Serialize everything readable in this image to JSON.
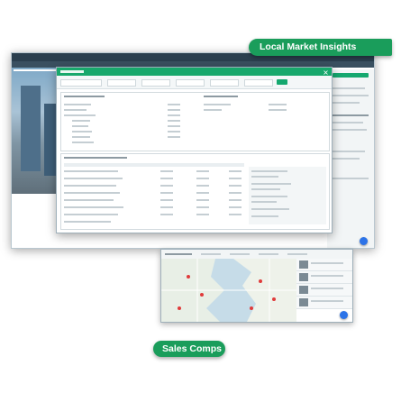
{
  "callouts": {
    "top": "Local Market Insights",
    "bottom": "Sales Comps"
  },
  "icons": {
    "window_close": "close-icon",
    "map_pins": "map-pin-icon",
    "chat_button": "chat-icon"
  },
  "colors": {
    "accent_green": "#1a9d5b",
    "header_green": "#18a86c",
    "nav_dark": "#2b3f4e",
    "chat_blue": "#2c73e8"
  }
}
